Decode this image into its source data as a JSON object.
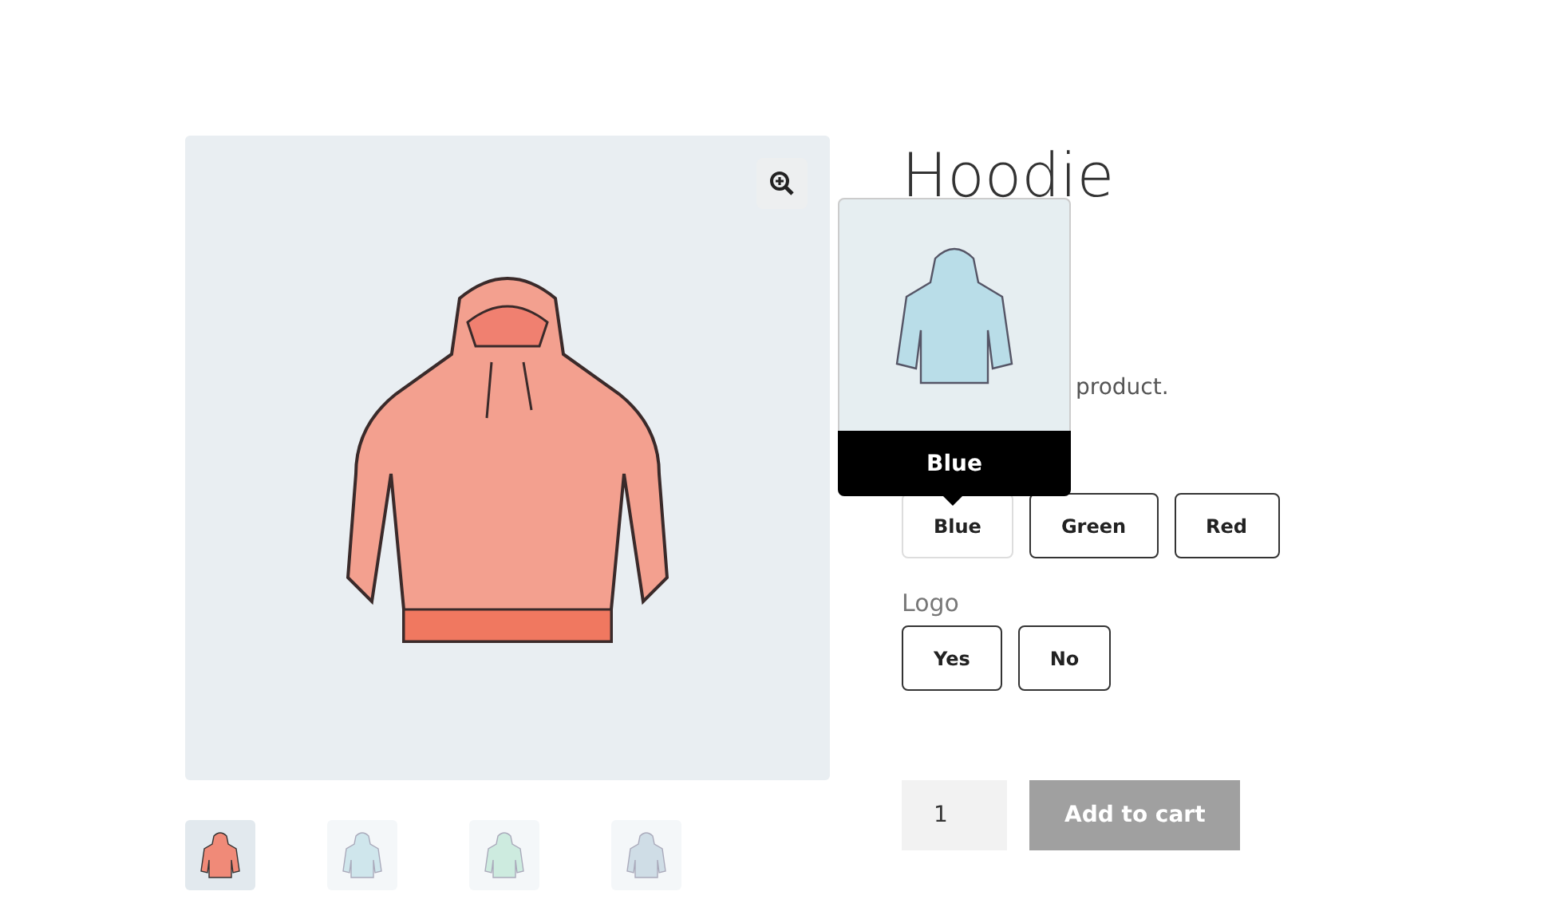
{
  "product": {
    "title": "Hoodie",
    "description_fragment": "product."
  },
  "gallery": {
    "thumbnails": [
      {
        "color": "#f08a78",
        "selected": true
      },
      {
        "color": "#cfe6ec",
        "selected": false
      },
      {
        "color": "#cdebdf",
        "selected": false
      },
      {
        "color": "#cfdde6",
        "selected": false
      }
    ]
  },
  "tooltip": {
    "label": "Blue"
  },
  "attributes": [
    {
      "options": [
        {
          "label": "Blue",
          "selected": true
        },
        {
          "label": "Green",
          "selected": false
        },
        {
          "label": "Red",
          "selected": false
        }
      ]
    },
    {
      "label": "Logo",
      "options": [
        {
          "label": "Yes",
          "selected": false
        },
        {
          "label": "No",
          "selected": false
        }
      ]
    }
  ],
  "quantity": {
    "value": "1"
  },
  "add_to_cart": {
    "label": "Add to cart",
    "disabled": true
  }
}
